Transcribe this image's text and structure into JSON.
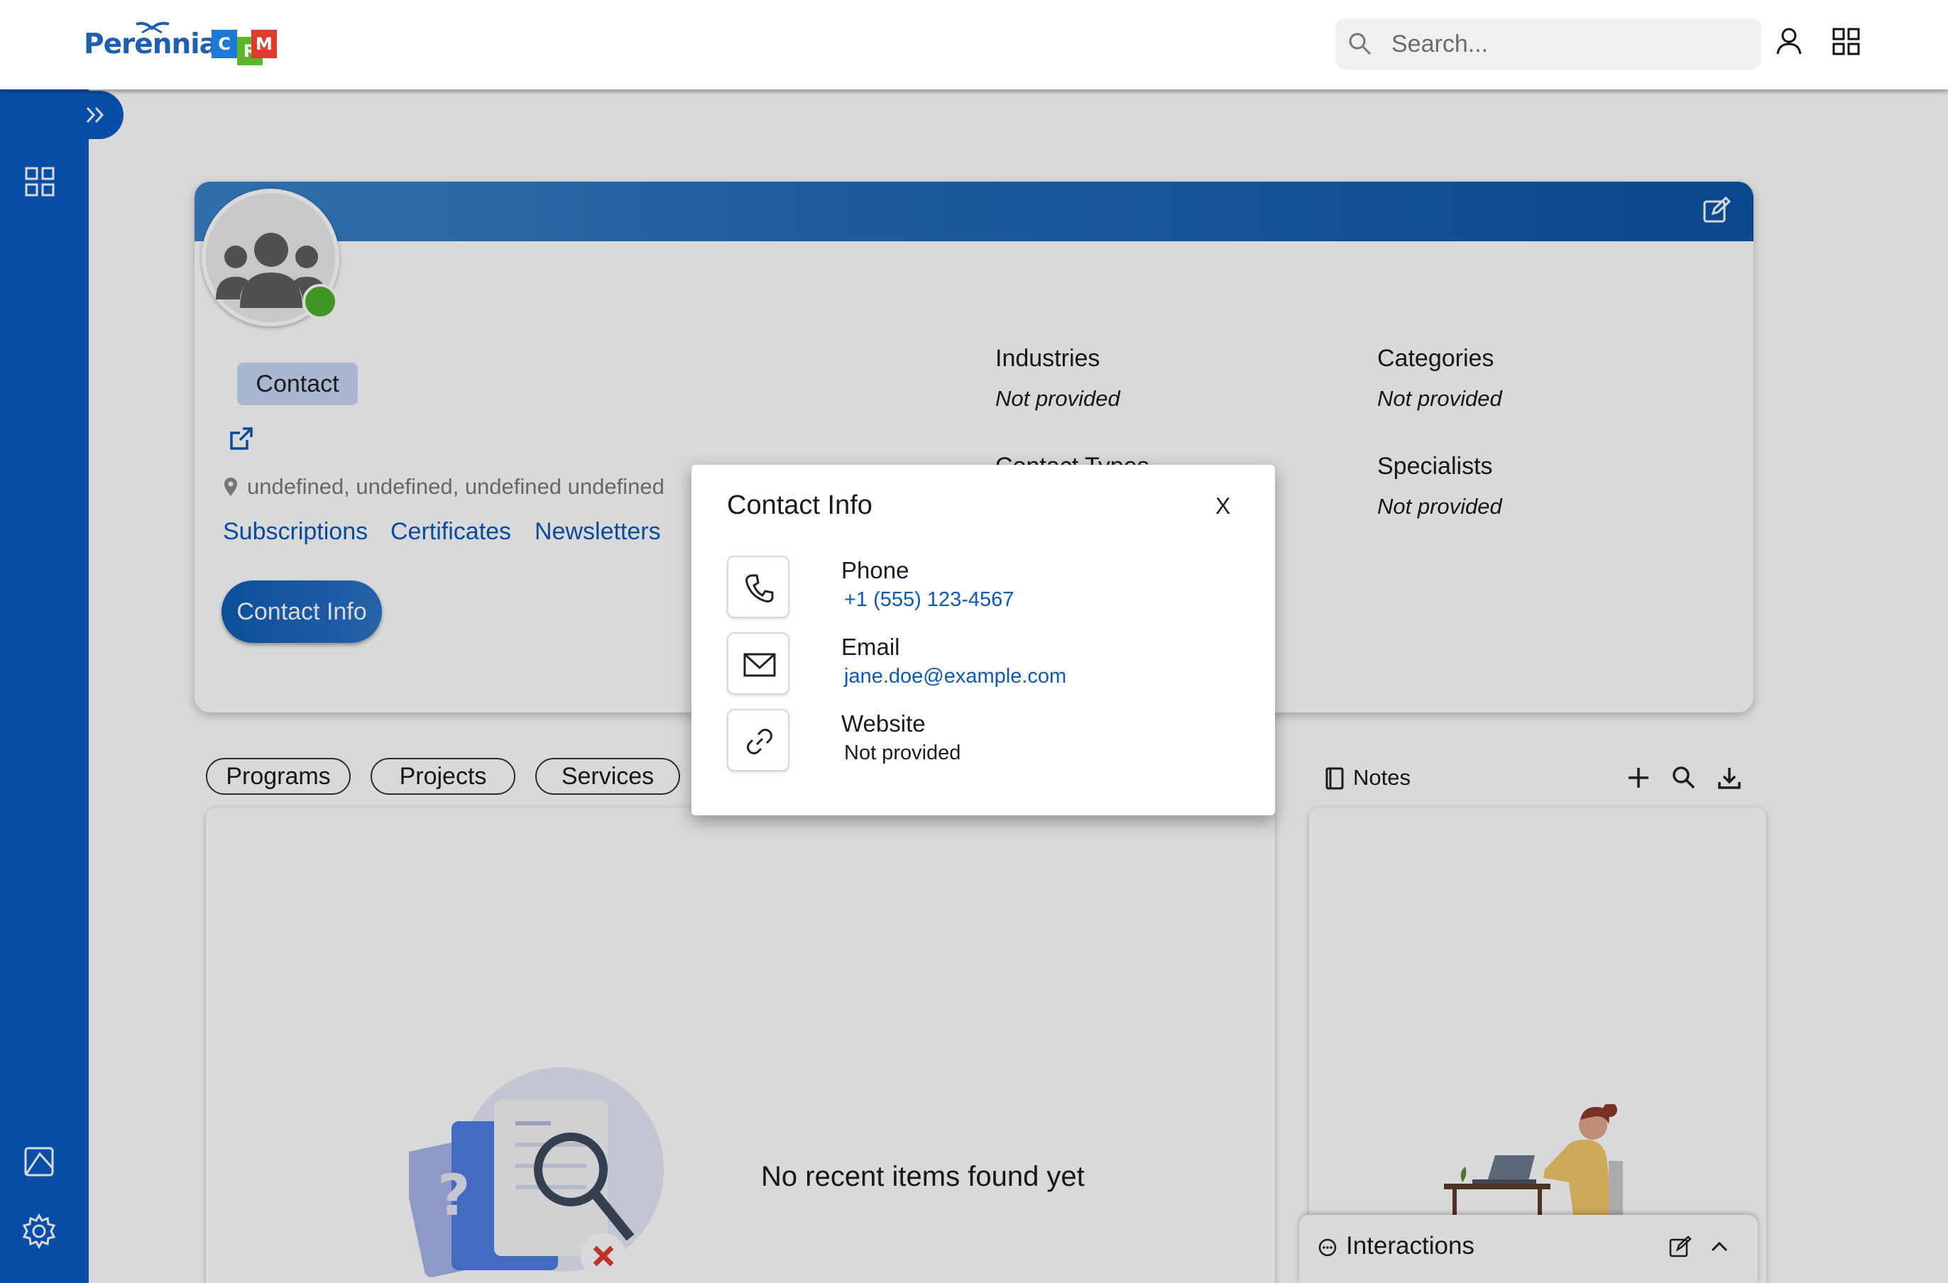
{
  "header": {
    "logo_text": "Perennia",
    "crm_letters": [
      "C",
      "R",
      "M"
    ],
    "search_placeholder": "Search..."
  },
  "profile": {
    "badge": "Contact",
    "location": "undefined, undefined, undefined undefined",
    "links": [
      "Subscriptions",
      "Certificates",
      "Newsletters"
    ],
    "contact_info_button": "Contact Info",
    "fields": {
      "industries": {
        "label": "Industries",
        "value": "Not provided"
      },
      "categories": {
        "label": "Categories",
        "value": "Not provided"
      },
      "contact_types": {
        "label": "Contact Types"
      },
      "specialists": {
        "label": "Specialists",
        "value": "Not provided"
      }
    }
  },
  "tabs": [
    "Programs",
    "Projects",
    "Services"
  ],
  "recent": {
    "empty_text": "No recent items found yet"
  },
  "notes": {
    "title": "Notes"
  },
  "interactions": {
    "title": "Interactions"
  },
  "modal": {
    "title": "Contact Info",
    "close": "X",
    "phone": {
      "label": "Phone",
      "value": "+1 (555) 123-4567"
    },
    "email": {
      "label": "Email",
      "value": "jane.doe@example.com"
    },
    "website": {
      "label": "Website",
      "value": "Not provided"
    }
  },
  "colors": {
    "brand_blue": "#0a5bc4",
    "link_blue": "#0a59b8",
    "status_green": "#4caf2a",
    "crm_c": "#1d79d6",
    "crm_r": "#5db52a",
    "crm_m": "#e03b2f"
  }
}
